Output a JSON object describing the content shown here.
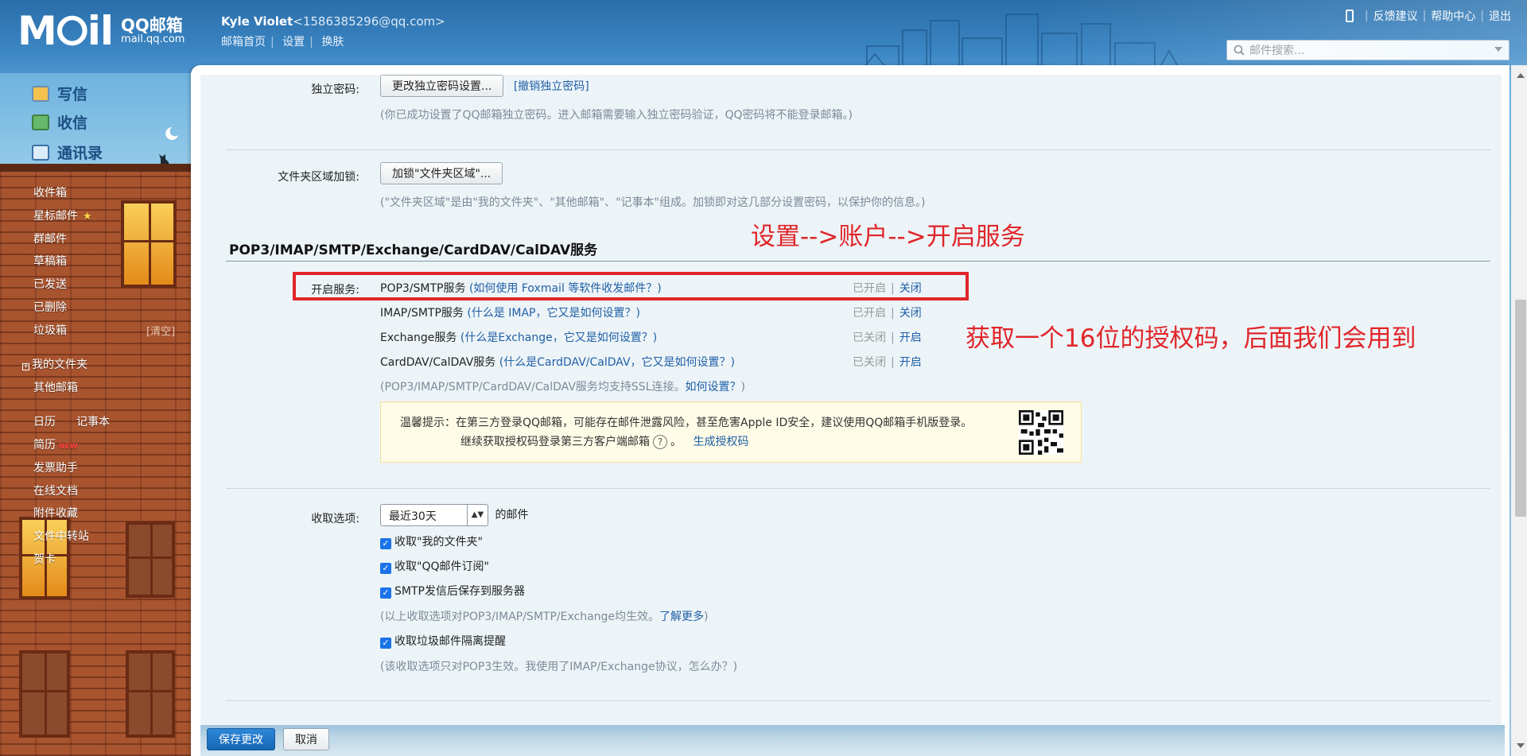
{
  "header": {
    "logo_mark": "M⭘il",
    "logo_title": "QQ邮箱",
    "logo_domain": "mail.qq.com",
    "user_name": "Kyle Violet",
    "user_email": "<1586385296@qq.com>",
    "links": [
      "邮箱首页",
      "设置",
      "换肤"
    ],
    "top_links": [
      "反馈建议",
      "帮助中心",
      "退出"
    ],
    "search_placeholder": "邮件搜索..."
  },
  "sidebar": {
    "primary": [
      "写信",
      "收信",
      "通讯录"
    ],
    "folders": [
      "收件箱",
      "星标邮件",
      "群邮件",
      "草稿箱",
      "已发送",
      "已删除",
      "垃圾箱"
    ],
    "clear_label": "[清空]",
    "my_folders": "我的文件夹",
    "other_mail": "其他邮箱",
    "calendar": "日历",
    "notes": "记事本",
    "resume": "简历",
    "new_badge": "NEW",
    "tools": [
      "发票助手",
      "在线文档",
      "附件收藏",
      "文件中转站",
      "贺卡"
    ]
  },
  "settings": {
    "indep_pwd_label": "独立密码:",
    "indep_pwd_button": "更改独立密码设置...",
    "indep_pwd_cancel": "[撤销独立密码]",
    "indep_pwd_hint": "(你已成功设置了QQ邮箱独立密码。进入邮箱需要输入独立密码验证，QQ密码将不能登录邮箱。)",
    "folder_lock_label": "文件夹区域加锁:",
    "folder_lock_button": "加锁\"文件夹区域\"...",
    "folder_lock_hint": "(\"文件夹区域\"是由\"我的文件夹\"、\"其他邮箱\"、\"记事本\"组成。加锁即对这几部分设置密码，以保护你的信息。)",
    "section_title": "POP3/IMAP/SMTP/Exchange/CardDAV/CalDAV服务",
    "enable_label": "开启服务:",
    "services": [
      {
        "name": "POP3/SMTP服务",
        "help": "(如何使用 Foxmail 等软件收发邮件？)",
        "state": "已开启",
        "action": "关闭"
      },
      {
        "name": "IMAP/SMTP服务",
        "help": "(什么是 IMAP，它又是如何设置？)",
        "state": "已开启",
        "action": "关闭"
      },
      {
        "name": "Exchange服务",
        "help": "(什么是Exchange，它又是如何设置？)",
        "state": "已关闭",
        "action": "开启"
      },
      {
        "name": "CardDAV/CalDAV服务",
        "help": "(什么是CardDAV/CalDAV，它又是如何设置？)",
        "state": "已关闭",
        "action": "开启"
      }
    ],
    "ssl_hint_a": "(POP3/IMAP/SMTP/CardDAV/CalDAV服务均支持SSL连接。",
    "ssl_hint_link": "如何设置？",
    "ssl_hint_b": ")",
    "warn_line1": "温馨提示：在第三方登录QQ邮箱，可能存在邮件泄露风险，甚至危害Apple ID安全，建议使用QQ邮箱手机版登录。",
    "warn_line2": "继续获取授权码登录第三方客户端邮箱",
    "warn_q": "?",
    "warn_link": "生成授权码",
    "recv_label": "收取选项:",
    "recv_select": "最近30天",
    "recv_suffix": "的邮件",
    "recv_opts": [
      "收取\"我的文件夹\"",
      "收取\"QQ邮件订阅\"",
      "SMTP发信后保存到服务器"
    ],
    "recv_hint_a": "(以上收取选项对POP3/IMAP/SMTP/Exchange均生效。",
    "recv_hint_link": "了解更多",
    "recv_hint_b": ")",
    "spam_opt": "收取垃圾邮件隔离提醒",
    "spam_hint": "(该收取选项只对POP3生效。我使用了IMAP/Exchange协议，怎么办？)"
  },
  "annotations": {
    "path": "设置-->账户-->开启服务",
    "tip": "获取一个16位的授权码，后面我们会用到"
  },
  "footer": {
    "save": "保存更改",
    "cancel": "取消"
  }
}
